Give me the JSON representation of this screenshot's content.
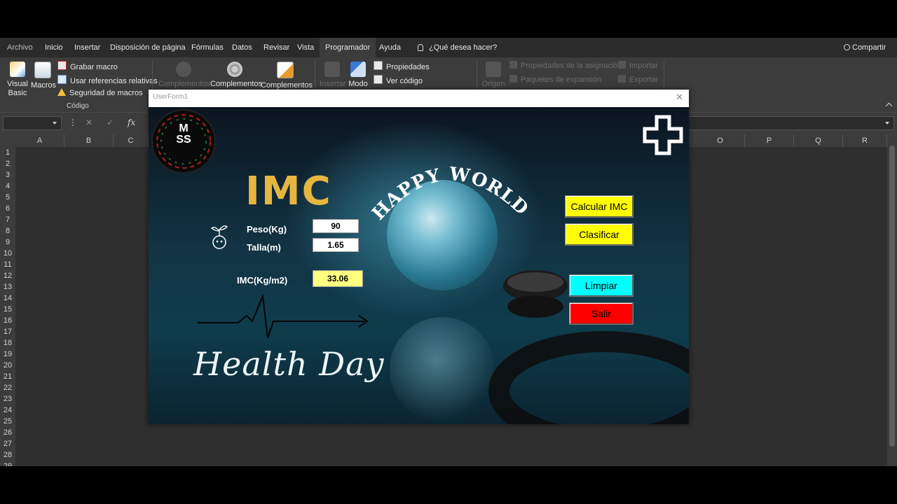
{
  "ribbon": {
    "tabs": [
      "Archivo",
      "Inicio",
      "Insertar",
      "Disposición de página",
      "Fórmulas",
      "Datos",
      "Revisar",
      "Vista",
      "Programador",
      "Ayuda",
      "¿Qué desea hacer?"
    ],
    "active_tab": "Programador",
    "share": "Compartir",
    "codigo": {
      "visual_basic": "Visual Basic",
      "macros": "Macros",
      "grabar_macro": "Grabar macro",
      "usar_referencias": "Usar referencias relativas",
      "seguridad_macros": "Seguridad de macros",
      "group_label": "Código"
    },
    "complementos": {
      "complementos_dis": "Complementos",
      "complementos_1": "Complementos",
      "complementos_2": "Complementos"
    },
    "controles": {
      "insertar": "Insertar",
      "modo": "Modo",
      "propiedades": "Propiedades",
      "ver_codigo": "Ver código"
    },
    "xml": {
      "origen": "Origen",
      "propiedades_asignacion": "Propiedades de la asignación",
      "paquetes_expansion": "Paquetes de expansión",
      "importar": "Importar",
      "exportar": "Exportar"
    }
  },
  "formula_bar": {
    "fx": "fx"
  },
  "columns": [
    "A",
    "B",
    "C",
    "O",
    "P",
    "Q",
    "R"
  ],
  "rows": [
    "1",
    "2",
    "3",
    "4",
    "5",
    "6",
    "7",
    "8",
    "9",
    "10",
    "11",
    "12",
    "13",
    "14",
    "15",
    "16",
    "17",
    "18",
    "19",
    "20",
    "21",
    "22",
    "23",
    "24",
    "25",
    "26",
    "27",
    "28",
    "29"
  ],
  "dialog": {
    "title": "UserForm1",
    "close": "✕",
    "logo": "M\nSS",
    "heading": "IMC",
    "banner": "HAPPY WORLD",
    "peso_label": "Peso(Kg)",
    "peso_value": "90",
    "talla_label": "Talla(m)",
    "talla_value": "1.65",
    "imc_label": "IMC(Kg/m2)",
    "imc_value": "33.06",
    "btn_calcular": "Calcular IMC",
    "btn_clasificar": "Clasificar",
    "btn_limpiar": "Limpiar",
    "btn_salir": "Salir",
    "footer_script": "Health Day"
  },
  "colors": {
    "imc_gold": "#e7b640",
    "btn_yellow": "#ffff00",
    "btn_cyan": "#00ffff",
    "btn_red": "#ff0000"
  }
}
